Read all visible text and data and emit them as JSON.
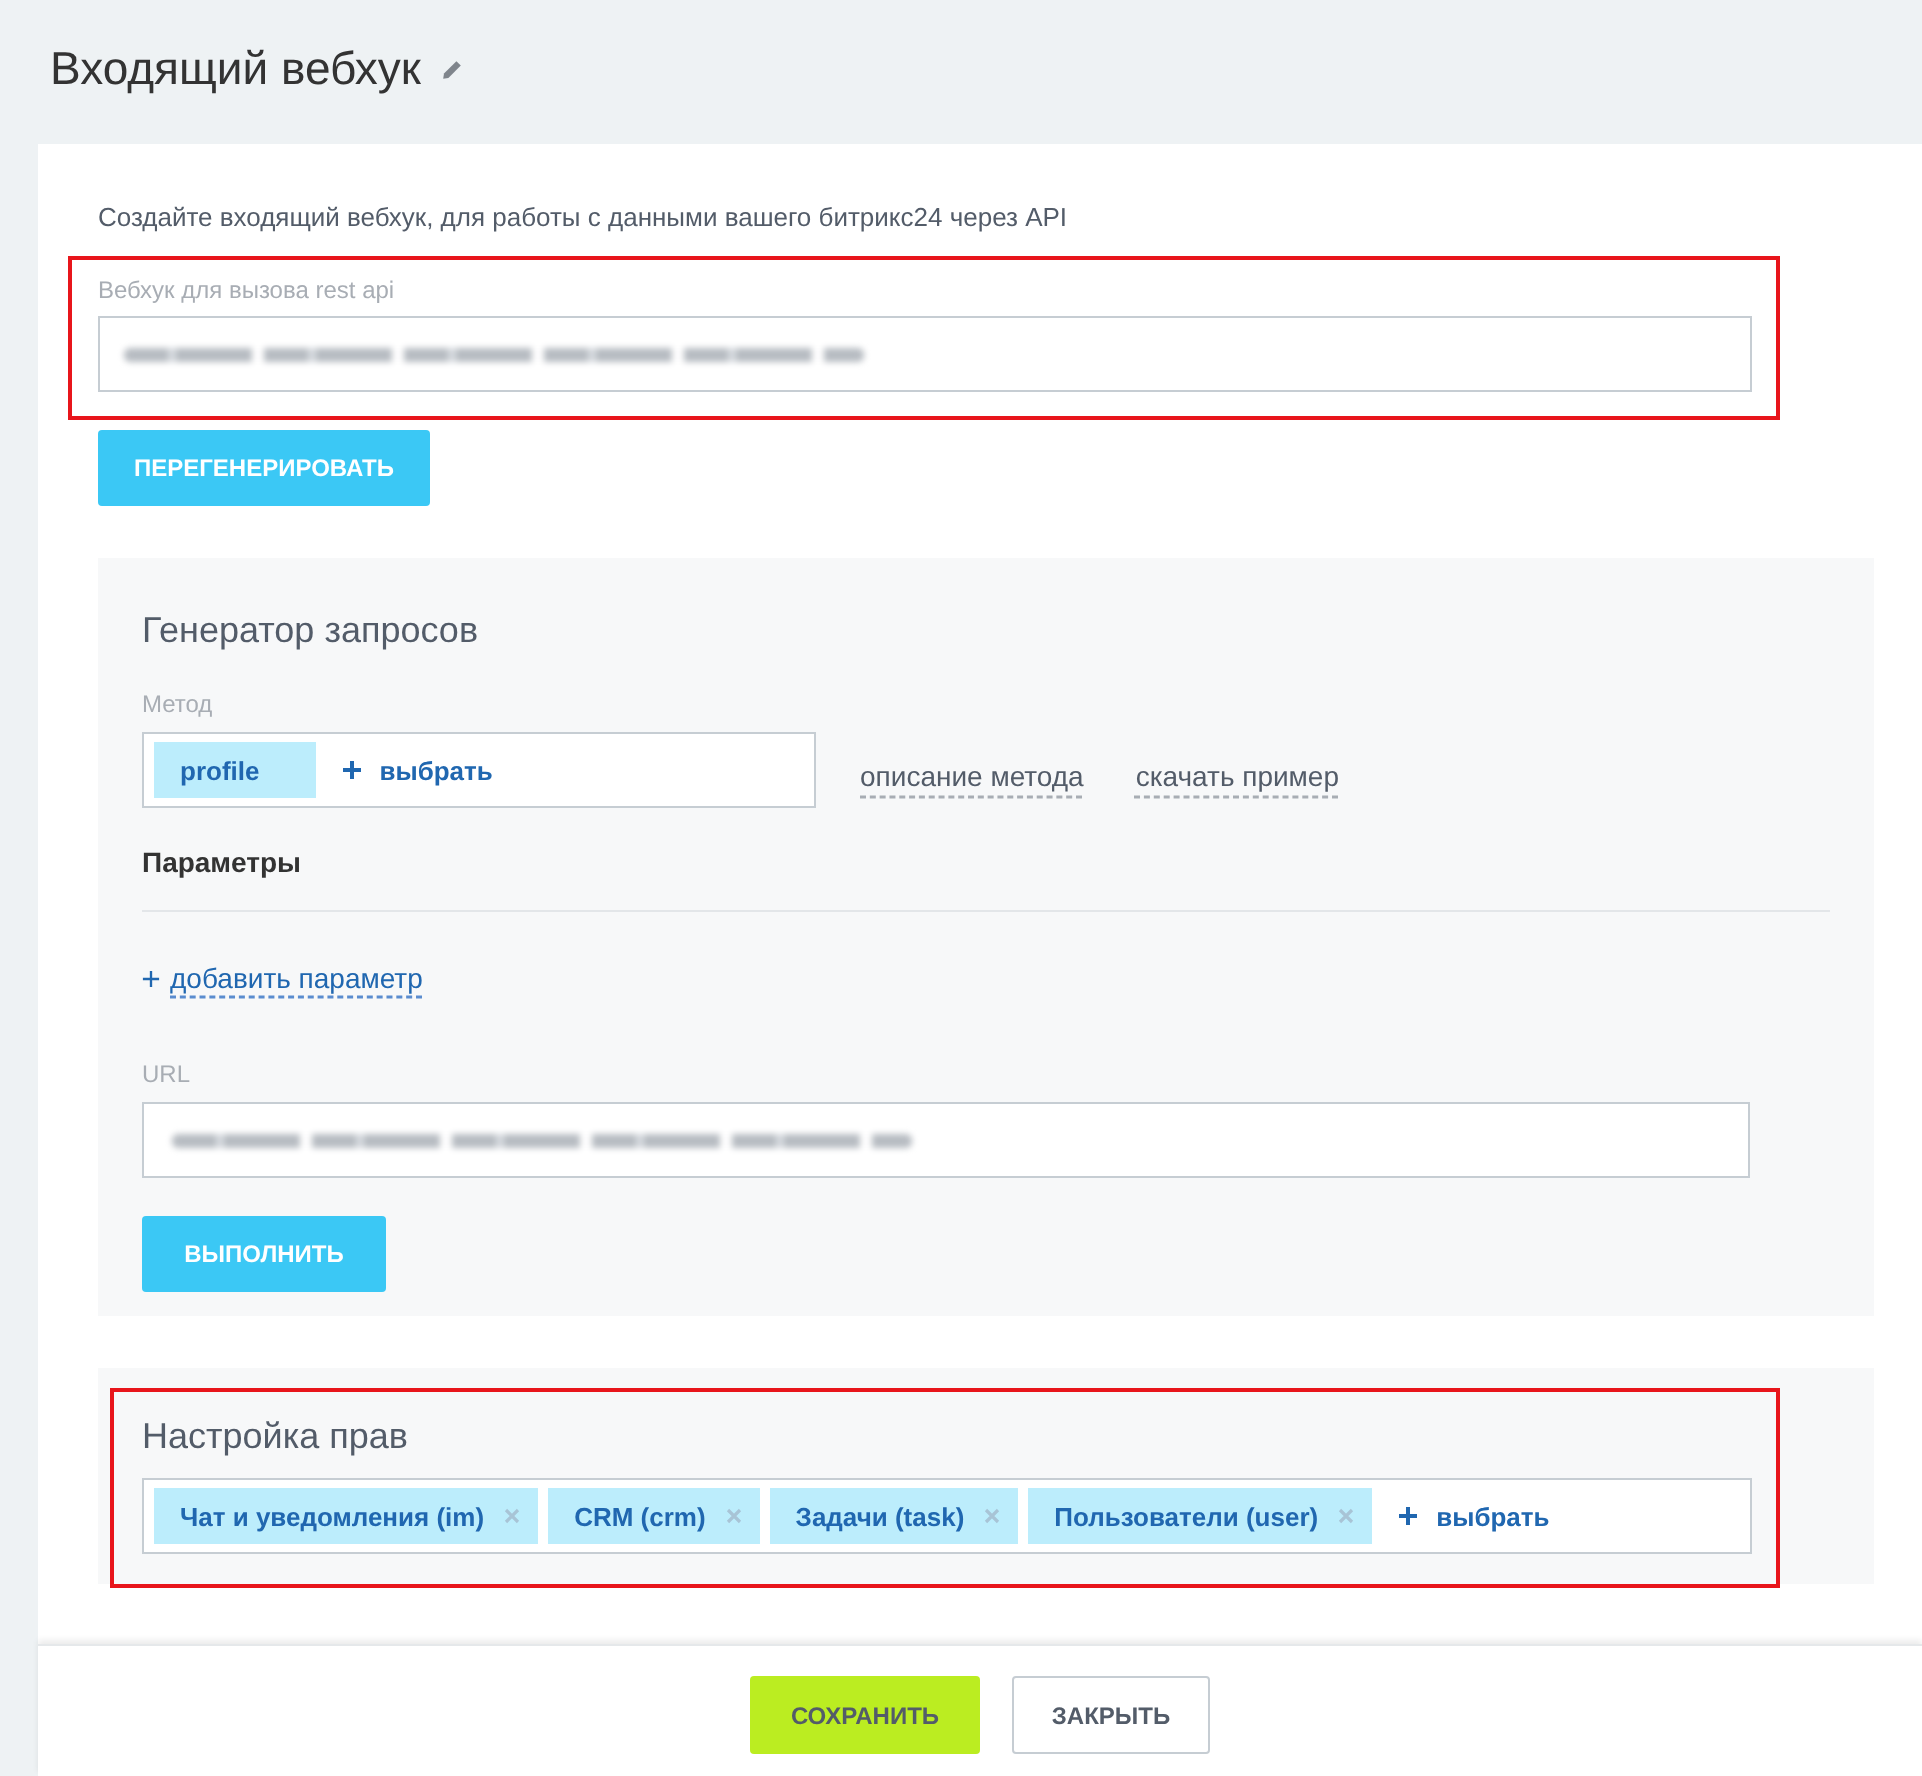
{
  "header": {
    "title": "Входящий вебхук"
  },
  "intro": "Создайте входящий вебхук, для работы с данными вашего битрикс24 через API",
  "webhook": {
    "label": "Вебхук для вызова rest api",
    "highlighted": true
  },
  "regenerate_button": "ПЕРЕГЕНЕРИРОВАТЬ",
  "generator": {
    "title": "Генератор запросов",
    "method": {
      "label": "Метод",
      "tags": [
        {
          "label": "profile",
          "removable": false
        }
      ],
      "add_label": "выбрать"
    },
    "links": [
      "описание метода",
      "скачать пример"
    ],
    "params_title": "Параметры",
    "add_param": "добавить параметр",
    "url": {
      "label": "URL"
    },
    "run_button": "ВЫПОЛНИТЬ"
  },
  "permissions": {
    "title": "Настройка прав",
    "highlighted": true,
    "tags": [
      {
        "label": "Чат и уведомления (im)",
        "removable": true
      },
      {
        "label": "CRM (crm)",
        "removable": true
      },
      {
        "label": "Задачи (task)",
        "removable": true
      },
      {
        "label": "Пользователи (user)",
        "removable": true
      }
    ],
    "add_label": "выбрать"
  },
  "footer": {
    "buttons": [
      {
        "label": "СОХРАНИТЬ",
        "kind": "primary"
      },
      {
        "label": "ЗАКРЫТЬ",
        "kind": "secondary"
      }
    ]
  }
}
